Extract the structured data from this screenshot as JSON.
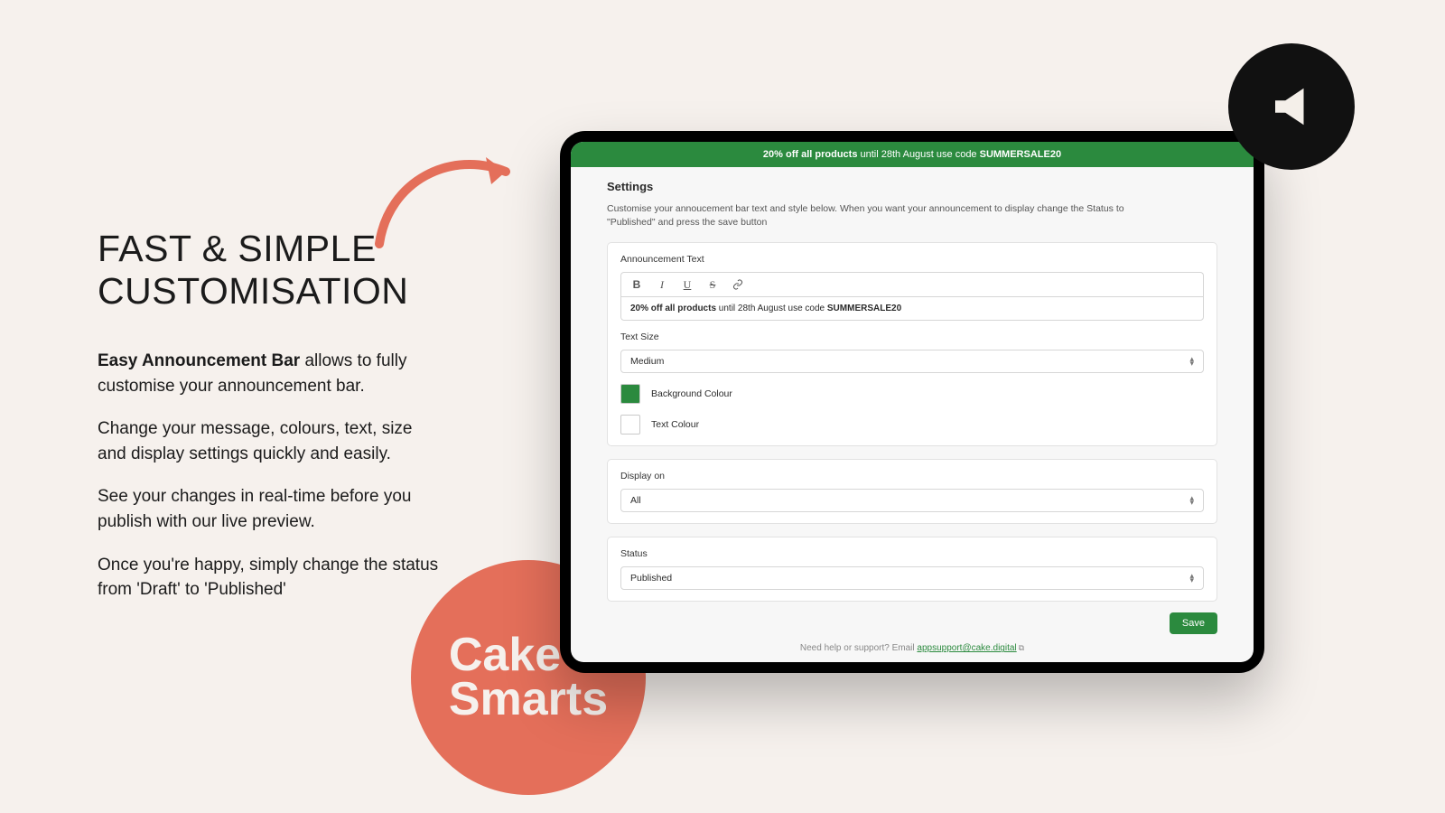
{
  "marketing": {
    "headline_line1": "FAST & SIMPLE",
    "headline_line2": "CUSTOMISATION",
    "para1_strong": "Easy Announcement Bar",
    "para1_rest": " allows to fully customise your announcement bar.",
    "para2": "Change your message, colours, text, size and display settings quickly and easily.",
    "para3": "See your changes in real-time before you publish with our live preview.",
    "para4": "Once you're happy, simply change the status from 'Draft' to 'Published'",
    "brand_line1": "Cake",
    "brand_line2": "Smarts"
  },
  "announcement": {
    "bold": "20% off all products",
    "mid": " until 28th August use code ",
    "code": "SUMMERSALE20"
  },
  "settings": {
    "title": "Settings",
    "description": "Customise your annoucement bar text and style below. When you want your announcement to display change the Status to \"Published\" and press the save button",
    "ann_text_label": "Announcement Text",
    "editor_bold": "20% off all products",
    "editor_mid": " until 28th August use code ",
    "editor_code": "SUMMERSALE20",
    "text_size_label": "Text Size",
    "text_size_value": "Medium",
    "bg_colour_label": "Background Colour",
    "text_colour_label": "Text Colour",
    "display_on_label": "Display on",
    "display_on_value": "All",
    "status_label": "Status",
    "status_value": "Published",
    "save_label": "Save",
    "support_prefix": "Need help or support? Email ",
    "support_email": "appsupport@cake.digital",
    "colors": {
      "background": "#2b8a3e",
      "text": "#ffffff"
    }
  }
}
